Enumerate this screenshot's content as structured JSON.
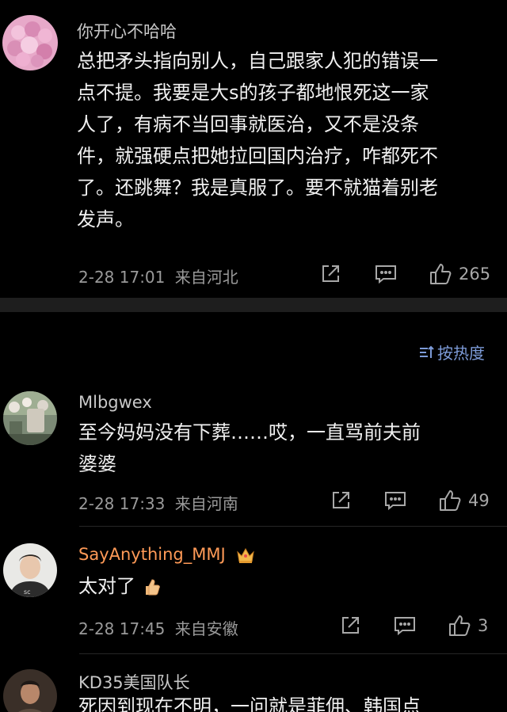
{
  "post": {
    "username": "你开心不哈哈",
    "body_lines": [
      "总把矛头指向别人，自己跟家人犯的错误一",
      "点不提。我要是大s的孩子都地恨死这一家",
      "人了，有病不当回事就医治，又不是没条",
      "件，就强硬点把她拉回国内治疗，咋都死不",
      "了。还跳舞？我是真服了。要不就猫着别老",
      "发声。"
    ],
    "timestamp": "2-28 17:01",
    "location": "来自河北",
    "like_count": "265"
  },
  "sort": {
    "label": "按热度"
  },
  "comments": [
    {
      "username": "Mlbgwex",
      "body_lines": [
        "至今妈妈没有下葬……哎，一直骂前夫前",
        "婆婆"
      ],
      "timestamp": "2-28 17:33",
      "location": "来自河南",
      "like_count": "49"
    },
    {
      "username": "SayAnything_MMJ",
      "username_color": "#ff9a57",
      "body_lines": [
        "太对了"
      ],
      "timestamp": "2-28 17:45",
      "location": "来自安徽",
      "like_count": "3"
    },
    {
      "username": "KD35美国队长",
      "body_lines": [
        "死因到现在不明，一问就是菲佣、韩国点"
      ]
    }
  ],
  "icons": {
    "share": "share-icon",
    "comment": "comment-icon",
    "like": "thumbs-up-icon",
    "sort": "sort-icon",
    "badge": "crown-icon"
  }
}
